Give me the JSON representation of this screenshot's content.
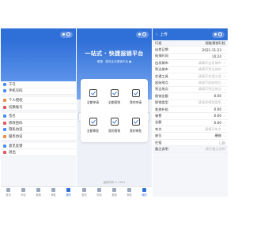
{
  "colors": {
    "brand": "#2f6fd8",
    "bg": "#f4f6fa",
    "placeholder": "#b5b5b5"
  },
  "panel1": {
    "menu_group1": [
      {
        "label": "工号",
        "icon": "id-icon",
        "color": "#4c8cf5"
      },
      {
        "label": "手机号码",
        "icon": "phone-icon",
        "color": "#4c8cf5"
      }
    ],
    "menu_group2": [
      {
        "label": "个人授权",
        "icon": "user-icon",
        "color": "#f08a4b"
      },
      {
        "label": "切换账号",
        "icon": "switch-icon",
        "color": "#e05a5a"
      }
    ],
    "menu_group3": [
      {
        "label": "签名",
        "icon": "pen-icon",
        "color": "#4c8cf5"
      },
      {
        "label": "修改密码",
        "icon": "lock-icon",
        "color": "#e05a5a"
      },
      {
        "label": "隐私协议",
        "icon": "shield-icon",
        "color": "#4c8cf5"
      },
      {
        "label": "服务协议",
        "icon": "doc-icon",
        "color": "#f08a4b"
      }
    ],
    "menu_group4": [
      {
        "label": "意见反馈",
        "icon": "feedback-icon",
        "color": "#4c8cf5"
      },
      {
        "label": "退出",
        "icon": "logout-icon",
        "color": "#e05a5a"
      }
    ]
  },
  "panel2": {
    "title": "一站式 · 快捷报销平台",
    "subtitle": "便捷 · 高效企业报销平台 ●",
    "items": [
      {
        "label": "全额申请",
        "icon": "apply-icon"
      },
      {
        "label": "全额报销",
        "icon": "reimburse-icon"
      },
      {
        "label": "我的申请",
        "icon": "mine-icon"
      },
      {
        "label": "全额审批",
        "icon": "approve-icon"
      },
      {
        "label": "我的报销",
        "icon": "myclaim-icon"
      },
      {
        "label": "我的审批",
        "icon": "myapprove-icon"
      }
    ],
    "footer": "版权所有 © 2021"
  },
  "panel3": {
    "back_label": "上传",
    "section": "行程",
    "section_value": "智能报销行程",
    "rows": [
      {
        "k": "出差日期",
        "v": "2021-11-23",
        "dark": true
      },
      {
        "k": "结束时间",
        "v": "10:24",
        "dark": true
      },
      {
        "k": "出发城市",
        "v": "请填写出发城市",
        "dark": false
      },
      {
        "k": "到达城市",
        "v": "请填写到达城市",
        "dark": false
      },
      {
        "k": "交通工具",
        "v": "请填写交通工具",
        "dark": false
      },
      {
        "k": "起始地点",
        "v": "请填写起始地点",
        "dark": false
      },
      {
        "k": "到达地点",
        "v": "请填写到达地点",
        "dark": false
      },
      {
        "k": "报销金额",
        "v": "0.00",
        "dark": true
      },
      {
        "k": "报销类型",
        "v": "请选择报销类型",
        "dark": false
      },
      {
        "k": "差旅补贴",
        "v": "0.00",
        "dark": true
      },
      {
        "k": "餐费",
        "v": "0.00",
        "dark": true
      },
      {
        "k": "金额",
        "v": "0.00",
        "dark": true
      },
      {
        "k": "车次",
        "v": "请填写车次",
        "dark": false
      },
      {
        "k": "座位",
        "v": "硬座",
        "dark": true
      }
    ],
    "toggle_label": "住宿",
    "extra_label": "备注说明",
    "extra_value": "填写备注说明"
  },
  "tabbar": [
    {
      "label": "首页",
      "active": false
    },
    {
      "label": "申请",
      "active": false
    },
    {
      "label": "报销",
      "active": false
    },
    {
      "label": "审批",
      "active": false
    },
    {
      "label": "我的",
      "active": true
    }
  ]
}
